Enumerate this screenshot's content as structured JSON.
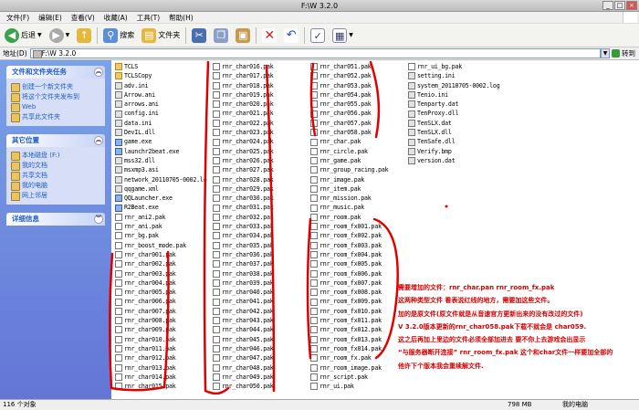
{
  "window": {
    "title": "F:\\W 3.2.0",
    "controls": [
      "_",
      "□",
      "×"
    ]
  },
  "menu": [
    "文件(F)",
    "编辑(E)",
    "查看(V)",
    "收藏(A)",
    "工具(T)",
    "帮助(H)"
  ],
  "toolbar": {
    "back": "后退",
    "search": "搜索",
    "folders": "文件夹"
  },
  "address": {
    "label": "地址(D)",
    "value": "F:\\W 3.2.0",
    "go": "转到"
  },
  "left": {
    "tasks_title": "文件和文件夹任务",
    "tasks": [
      "创建一个新文件夹",
      "将这个文件夹发布到",
      "Web",
      "共享此文件夹"
    ],
    "places_title": "其它位置",
    "places": [
      "本地磁盘 (F:)",
      "我的文档",
      "共享文档",
      "我的电脑",
      "网上邻居"
    ],
    "details_title": "详细信息"
  },
  "files": {
    "col1": [
      "TCLS",
      "TCLSCopy",
      "adv.ini",
      "Arrow.ani",
      "arrows.ani",
      "config.ini",
      "data.ini",
      "DevIL.dll",
      "game.exe",
      "launchr2beat.exe",
      "mss32.dll",
      "msxmp3.asi",
      "network_20110705-0002.lo",
      "qqgame.xml",
      "QQLauncher.exe",
      "R2Beat.exe",
      "rnr_ani2.pak",
      "rnr_ani.pak",
      "rnr_bg.pak",
      "rnr_boost_mode.pak",
      "rnr_char001.pak",
      "rnr_char002.pak",
      "rnr_char003.pak",
      "rnr_char004.pak",
      "rnr_char005.pak",
      "rnr_char006.pak",
      "rnr_char007.pak",
      "rnr_char008.pak",
      "rnr_char009.pak",
      "rnr_char010.pak",
      "rnr_char011.pak",
      "rnr_char012.pak",
      "rnr_char013.pak",
      "rnr_char014.pak",
      "rnr_char015.pak"
    ],
    "col2": [
      "rnr_char016.pak",
      "rnr_char017.pak",
      "rnr_char018.pak",
      "rnr_char019.pak",
      "rnr_char020.pak",
      "rnr_char021.pak",
      "rnr_char022.pak",
      "rnr_char023.pak",
      "rnr_char024.pak",
      "rnr_char025.pak",
      "rnr_char026.pak",
      "rnr_char027.pak",
      "rnr_char028.pak",
      "rnr_char029.pak",
      "rnr_char030.pak",
      "rnr_char031.pak",
      "rnr_char032.pak",
      "rnr_char033.pak",
      "rnr_char034.pak",
      "rnr_char035.pak",
      "rnr_char036.pak",
      "rnr_char037.pak",
      "rnr_char038.pak",
      "rnr_char039.pak",
      "rnr_char040.pak",
      "rnr_char041.pak",
      "rnr_char042.pak",
      "rnr_char043.pak",
      "rnr_char044.pak",
      "rnr_char045.pak",
      "rnr_char046.pak",
      "rnr_char047.pak",
      "rnr_char048.pak",
      "rnr_char049.pak",
      "rnr_char050.pak"
    ],
    "col3": [
      "rnr_char051.pak",
      "rnr_char052.pak",
      "rnr_char053.pak",
      "rnr_char054.pak",
      "rnr_char055.pak",
      "rnr_char056.pak",
      "rnr_char057.pak",
      "rnr_char058.pak",
      "rnr_char.pak",
      "rnr_circle.pak",
      "rnr_game.pak",
      "rnr_group_racing.pak",
      "rnr_image.pak",
      "rnr_item.pak",
      "rnr_mission.pak",
      "rnr_music.pak",
      "rnr_room.pak",
      "rnr_room_fx001.pak",
      "rnr_room_fx002.pak",
      "rnr_room_fx003.pak",
      "rnr_room_fx004.pak",
      "rnr_room_fx005.pak",
      "rnr_room_fx006.pak",
      "rnr_room_fx007.pak",
      "rnr_room_fx008.pak",
      "rnr_room_fx009.pak",
      "rnr_room_fx010.pak",
      "rnr_room_fx011.pak",
      "rnr_room_fx012.pak",
      "rnr_room_fx013.pak",
      "rnr_room_fx014.pak",
      "rnr_room_fx.pak",
      "rnr_room_image.pak",
      "rnr_script.pak",
      "rnr_ui.pak"
    ],
    "col4": [
      "rnr_ui_bg.pak",
      "setting.ini",
      "system_20110705-0002.log",
      "Tenio.ini",
      "Tenparty.dat",
      "TenProxy.dll",
      "TenSLX.dat",
      "TenSLX.dll",
      "TenSafe.dll",
      "Verify.bmp",
      "version.dat"
    ]
  },
  "annotation": [
    "需要增加的文件：rnr_char.pan    rnr_room_fx.pak",
    "这两种类型文件 看表说红线的地方，需要加这些文件。",
    "加的是原文件(原文件就是从音速官方更新出来的没有改过的文件)",
    "V 3.2.0版本更新的rnr_char058.pak下载不就会是 char059.",
    "这之后再加上里边的文件必须全部加进去 要不你上去游戏会出显示",
    "“与服务器断开连接” rnr_room_fx.pak  这个和char文件一样要加全部的",
    "他许下个版本我会重续解文件."
  ],
  "status": {
    "count": "116 个对象",
    "size": "798 MB",
    "location": "我的电脑"
  },
  "colors": {
    "annotation": "#d40000",
    "xp_blue": "#6375d6"
  }
}
